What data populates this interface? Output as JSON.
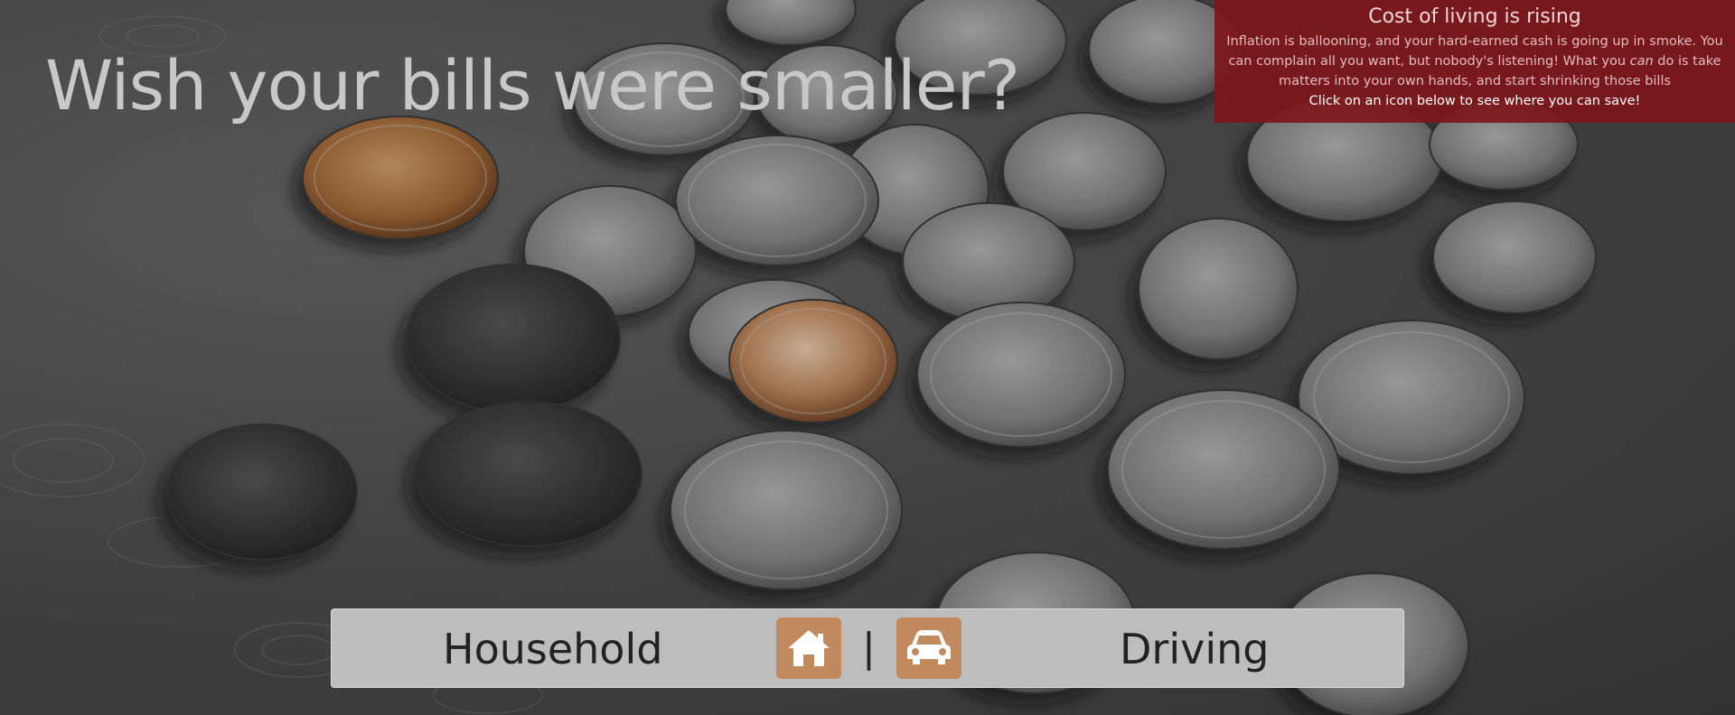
{
  "hero": {
    "headline": "Wish your bills were smaller?"
  },
  "info_panel": {
    "title": "Cost of living is rising",
    "text_before": "Inflation is ballooning, and your hard-earned cash is going up in smoke. You can complain all you want, but nobody's listening! What you ",
    "text_emphasis": "can",
    "text_after": " do is take matters into your own hands, and start shrinking those bills",
    "cta": "Click on an icon below to see where you can save!",
    "background_color": "#7d161a"
  },
  "nav": {
    "household_label": "Household",
    "separator": "|",
    "driving_label": "Driving",
    "household_icon": "home-icon",
    "driving_icon": "car-icon",
    "tile_color": "#c0895e"
  }
}
